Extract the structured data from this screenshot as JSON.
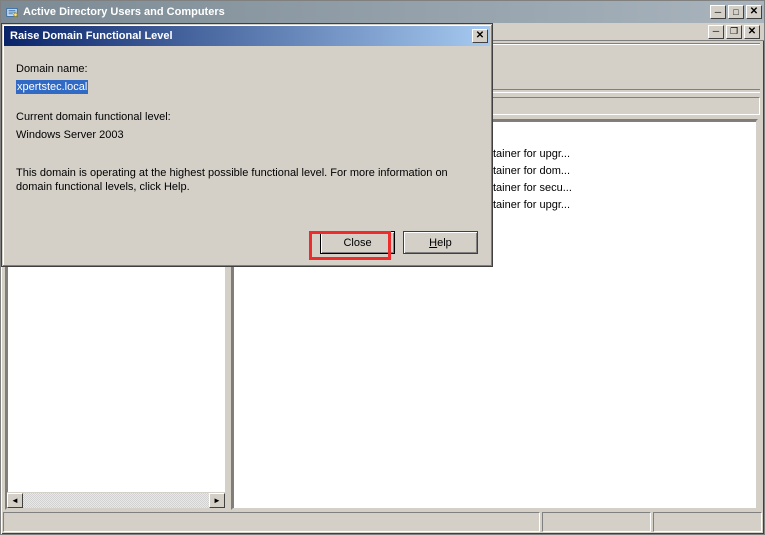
{
  "main_window": {
    "title": "Active Directory Users and Computers"
  },
  "list": {
    "rows": [
      "tainer for upgr...",
      "tainer for dom...",
      "tainer for secu...",
      "tainer for upgr..."
    ]
  },
  "dialog": {
    "title": "Raise Domain Functional Level",
    "domain_name_label": "Domain name:",
    "domain_name_value": "xpertstec.local",
    "current_level_label": "Current domain functional level:",
    "current_level_value": "Windows Server 2003",
    "info_text": "This domain is operating at the highest possible functional level. For more information on domain functional levels, click Help.",
    "close_label": "Close",
    "help_label": "Help"
  },
  "glyphs": {
    "minimize": "─",
    "maximize": "□",
    "restore": "❐",
    "close": "✕",
    "left": "◄",
    "right": "►"
  }
}
